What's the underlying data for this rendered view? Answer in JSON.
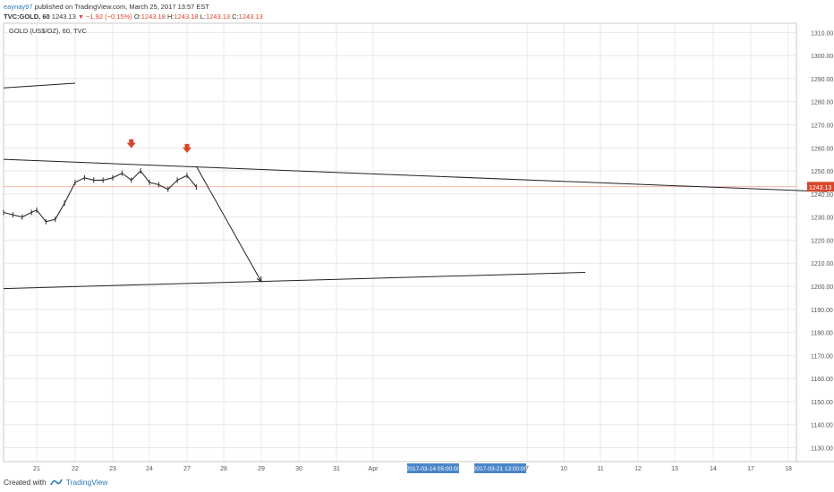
{
  "header": {
    "author": "eaynay97",
    "published_text": " published on TradingView.com, March 25, 2017 13:57 EST",
    "symbol_line": "TVC:GOLD, 60",
    "last": "1243.13",
    "change": "−1.92 (−0.15%)",
    "o_label": "O:",
    "o_value": "1243.18",
    "h_label": "H:",
    "h_value": "1243.18",
    "l_label": "L:",
    "l_value": "1243.13",
    "c_label": "C:",
    "c_value": "1243.13"
  },
  "legend": {
    "title": "GOLD (US$/OZ), 60, TVC"
  },
  "footer": {
    "created_with": "Created with",
    "brand": "TradingView"
  },
  "colors": {
    "down": "#d9452b",
    "price_line": "#f0a08c",
    "grid": "#e8e8e8",
    "time_label_bg": "#4a86c8",
    "brand": "#2a7ab8"
  },
  "chart_data": {
    "type": "line",
    "title": "GOLD (US$/OZ), 60, TVC",
    "y_axis_ticks": [
      "1310.00",
      "1300.00",
      "1290.00",
      "1280.00",
      "1270.00",
      "1260.00",
      "1250.00",
      "1240.00",
      "1230.00",
      "1220.00",
      "1210.00",
      "1200.00",
      "1190.00",
      "1180.00",
      "1170.00",
      "1160.00",
      "1150.00",
      "1140.00",
      "1130.00"
    ],
    "x_axis_ticks": [
      "21",
      "22",
      "23",
      "24",
      "27",
      "28",
      "29",
      "30",
      "31",
      "Apr",
      "2017-03-14 05:00:00",
      "2017-03-21 13:00:00",
      "7",
      "10",
      "11",
      "12",
      "13",
      "14",
      "17",
      "18"
    ],
    "ylim": [
      1124,
      1314
    ],
    "last_price": "1243.13",
    "last_price_value": 1243.13,
    "price_series": {
      "name": "GOLD",
      "points": [
        [
          "20 00:00",
          1232
        ],
        [
          "20 06:00",
          1231
        ],
        [
          "20 12:00",
          1230
        ],
        [
          "20 18:00",
          1232
        ],
        [
          "21 00:00",
          1233
        ],
        [
          "21 06:00",
          1228
        ],
        [
          "21 12:00",
          1229
        ],
        [
          "21 18:00",
          1236
        ],
        [
          "22 00:00",
          1245
        ],
        [
          "22 06:00",
          1247
        ],
        [
          "22 12:00",
          1246
        ],
        [
          "22 18:00",
          1246
        ],
        [
          "23 00:00",
          1247
        ],
        [
          "23 06:00",
          1249
        ],
        [
          "23 12:00",
          1246
        ],
        [
          "23 18:00",
          1250
        ],
        [
          "24 00:00",
          1245
        ],
        [
          "24 06:00",
          1244
        ],
        [
          "24 12:00",
          1242
        ],
        [
          "24 18:00",
          1246
        ],
        [
          "27 00:00",
          1248
        ],
        [
          "27 06:00",
          1243
        ]
      ]
    },
    "drawings": [
      {
        "name": "upper-resistance-line",
        "from": [
          "20 00:00",
          1255
        ],
        "to": [
          "18 00:00",
          1241
        ]
      },
      {
        "name": "lower-support-line",
        "from": [
          "20 00:00",
          1199
        ],
        "to": [
          "12 00:00",
          1206
        ]
      },
      {
        "name": "top-left-line",
        "from": [
          "20 00:00",
          1286
        ],
        "to": [
          "22 00:00",
          1288
        ]
      },
      {
        "name": "forecast-arrow",
        "from": [
          "27 06:00",
          1252
        ],
        "to": [
          "29 00:00",
          1202
        ]
      }
    ],
    "markers": [
      {
        "name": "top-marker-1",
        "at": [
          "23 12:00",
          1261
        ]
      },
      {
        "name": "top-marker-2",
        "at": [
          "27 00:00",
          1259
        ]
      }
    ],
    "grid": true
  }
}
